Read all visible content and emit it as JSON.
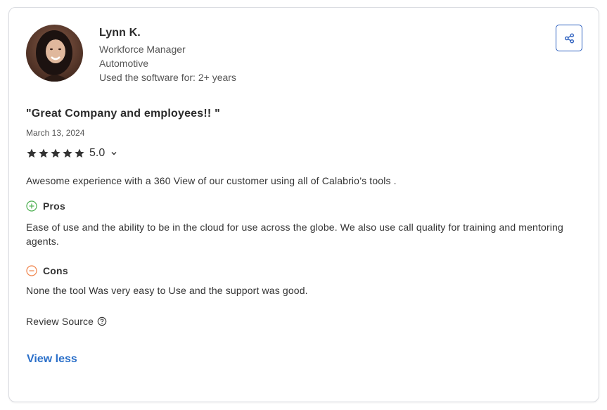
{
  "reviewer": {
    "name": "Lynn K.",
    "role": "Workforce Manager",
    "industry": "Automotive",
    "usage": "Used the software for: 2+ years"
  },
  "review": {
    "title": "\"Great Company and employees!! \"",
    "date": "March 13, 2024",
    "rating": "5.0",
    "stars": 5,
    "summary": "Awesome experience with a 360 View of our customer using all of Calabrio’s tools .",
    "pros_label": "Pros",
    "pros": "Ease of use and the ability to be in the cloud for use across the globe. We also use call quality for training and mentoring agents.",
    "cons_label": "Cons",
    "cons": "None the tool Was very easy to Use and the support was good.",
    "source_label": "Review Source",
    "view_less": "View less"
  },
  "icons": {
    "share": "share-icon",
    "star": "star-icon",
    "chevron": "chevron-down-icon",
    "pros": "plus-circle-icon",
    "cons": "minus-circle-icon",
    "help": "question-circle-icon"
  },
  "colors": {
    "accent": "#2c5fbf",
    "link": "#2a6fc9",
    "pros": "#4caf50",
    "cons": "#f0834a",
    "border": "#d9dbe0"
  }
}
